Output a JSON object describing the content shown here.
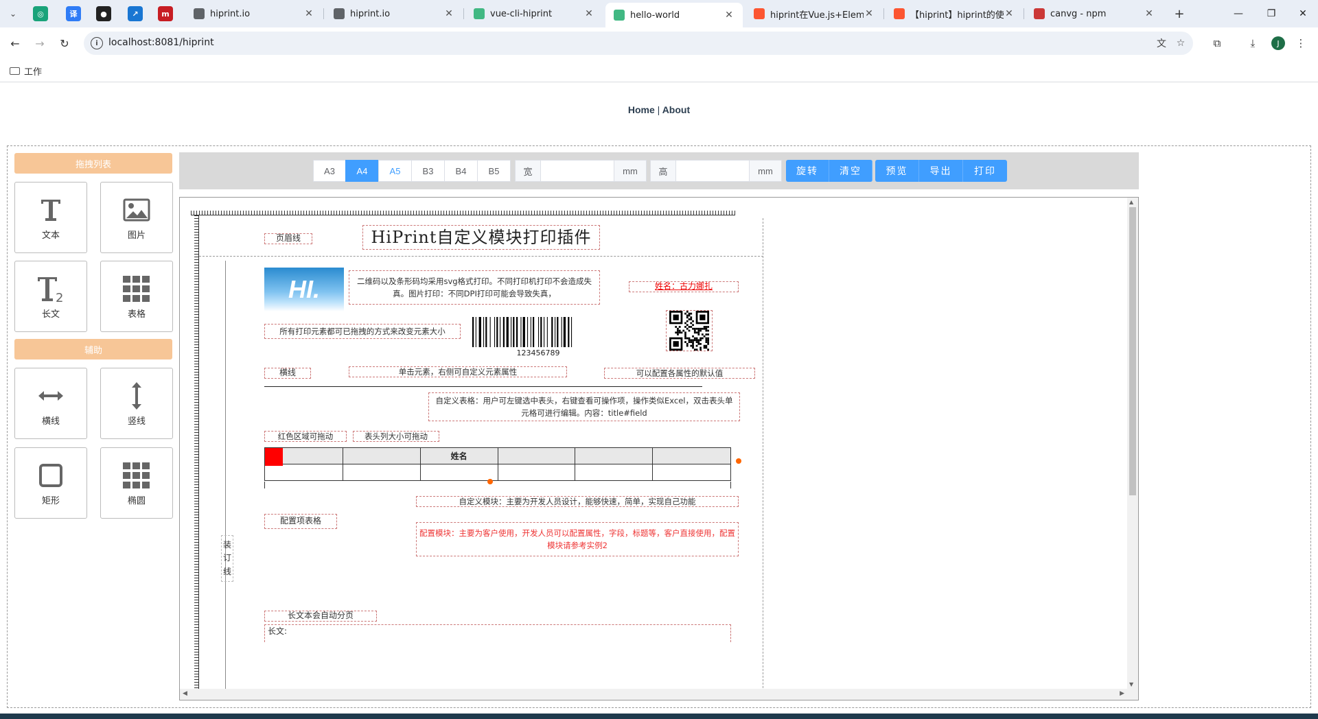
{
  "browser": {
    "tabs": [
      {
        "title": "hiprint.io",
        "favicon_color": "#5f6368"
      },
      {
        "title": "hiprint.io",
        "favicon_color": "#5f6368"
      },
      {
        "title": "vue-cli-hiprint",
        "favicon_color": "#41b883"
      },
      {
        "title": "hello-world",
        "favicon_color": "#41b883",
        "active": true
      },
      {
        "title": "hiprint在Vue.js+Elemen",
        "favicon_color": "#fc5531"
      },
      {
        "title": "【hiprint】hiprint的使用",
        "favicon_color": "#fc5531"
      },
      {
        "title": "canvg - npm",
        "favicon_color": "#cb3837"
      }
    ],
    "pinned": [
      {
        "icon": "openai-icon",
        "glyph": "◎",
        "color": "#1aa37a"
      },
      {
        "icon": "translate-icon",
        "glyph": "译",
        "color": "#2f7cf6"
      },
      {
        "icon": "github-icon",
        "glyph": "●",
        "color": "#222"
      },
      {
        "icon": "share-icon",
        "glyph": "↗",
        "color": "#1976d2"
      },
      {
        "icon": "gitee-icon",
        "glyph": "m",
        "color": "#c71d23"
      }
    ],
    "url": "localhost:8081/hiprint",
    "profile_initial": "J",
    "bookmark_folder": "工作"
  },
  "nav": {
    "home": "Home",
    "separator": "|",
    "about": "About"
  },
  "sidebar": {
    "section1_title": "拖拽列表",
    "section2_title": "辅助",
    "tools1": [
      {
        "label": "文本",
        "icon": "text-icon"
      },
      {
        "label": "图片",
        "icon": "image-icon"
      },
      {
        "label": "长文",
        "icon": "longtext-icon"
      },
      {
        "label": "表格",
        "icon": "table-icon"
      }
    ],
    "tools2": [
      {
        "label": "横线",
        "icon": "hline-icon"
      },
      {
        "label": "竖线",
        "icon": "vline-icon"
      },
      {
        "label": "矩形",
        "icon": "rect-icon"
      },
      {
        "label": "椭圆",
        "icon": "ellipse-icon"
      }
    ]
  },
  "paper_toolbar": {
    "sizes": [
      "A3",
      "A4",
      "A5",
      "B3",
      "B4",
      "B5"
    ],
    "selected_size": "A4",
    "width_label": "宽",
    "width_value": "",
    "width_unit": "mm",
    "height_label": "高",
    "height_value": "",
    "height_unit": "mm",
    "rotate": "旋转",
    "clear": "清空",
    "preview": "预览",
    "export": "导出",
    "print": "打印"
  },
  "template": {
    "header_line_label": "页眉线",
    "title": "HiPrint自定义模块打印插件",
    "image_text": "HI.",
    "svg_note": "二维码以及条形码均采用svg格式打印。不同打印机打印不会造成失真。图片打印：不同DPI打印可能会导致失真，",
    "name_field": "姓名：古力娜扎",
    "drag_resize_note": "所有打印元素都可已拖拽的方式来改变元素大小",
    "barcode_value": "123456789",
    "hline_label": "横线",
    "click_note": "单击元素，右侧可自定义元素属性",
    "default_note": "可以配置各属性的默认值",
    "table_note": "自定义表格：用户可左键选中表头，右键查看可操作项，操作类似Excel，双击表头单元格可进行编辑。内容：title#field",
    "red_area_note": "红色区域可拖动",
    "col_resize_note": "表头列大小可拖动",
    "table_header_name": "姓名",
    "binding_line": [
      "装",
      "订",
      "线"
    ],
    "custom_module_note": "自定义模块：主要为开发人员设计，能够快速，简单，实现自己功能",
    "config_table_label": "配置项表格",
    "config_module_note": "配置模块：主要为客户使用，开发人员可以配置属性，字段，标题等，客户直接使用，配置模块请参考实例2",
    "longtext_paging": "长文本会自动分页",
    "longtext_label": "长文:"
  },
  "colors": {
    "accent_blue": "#409eff",
    "sidebar_header": "#f7c697",
    "red": "#ff0000",
    "handle_orange": "#ff6600"
  }
}
